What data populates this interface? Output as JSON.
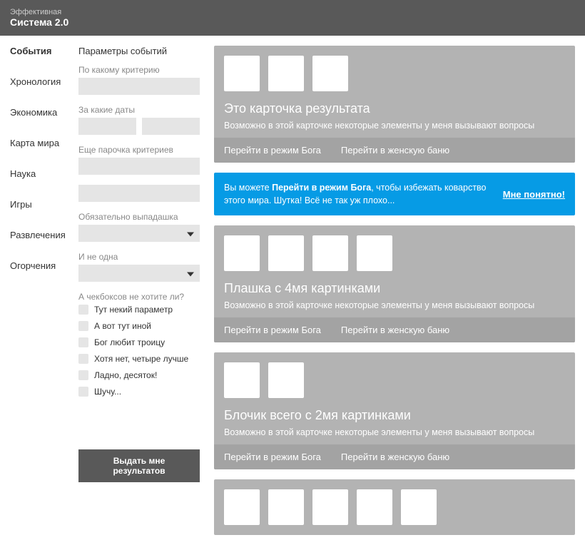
{
  "header": {
    "sub": "Эффективная",
    "title": "Система 2.0"
  },
  "nav": {
    "items": [
      {
        "label": "События",
        "active": true
      },
      {
        "label": "Хронология"
      },
      {
        "label": "Экономика"
      },
      {
        "label": "Карта мира"
      },
      {
        "label": "Наука"
      },
      {
        "label": "Игры"
      },
      {
        "label": "Развлечения"
      },
      {
        "label": "Огорчения"
      }
    ]
  },
  "filters": {
    "title": "Параметры событий",
    "criterion_label": "По какому критерию",
    "dates_label": "За какие даты",
    "more_criteria_label": "Еще парочка критериев",
    "dropdown1_label": "Обязательно выпадашка",
    "dropdown2_label": "И не одна",
    "checkboxes_label": "А чекбоксов не хотите ли?",
    "checkboxes": [
      "Тут некий параметр",
      "А вот тут иной",
      "Бог любит троицу",
      "Хотя нет, четыре лучше",
      "Ладно, десяток!",
      "Шучу..."
    ],
    "submit": "Выдать мне результатов"
  },
  "notice": {
    "text_pre": "Вы можете ",
    "text_bold": "Перейти в режим Бога",
    "text_post": ", чтобы избежать коварство этого мира. Шутка! Всё не так уж плохо...",
    "link": "Мне понятно!"
  },
  "cards": [
    {
      "thumbs": 3,
      "title": "Это карточка результата",
      "desc": "Возможно в этой карточке некоторые элементы у меня вызывают вопросы",
      "action1": "Перейти в режим Бога",
      "action2": "Перейти в женскую баню"
    },
    {
      "thumbs": 4,
      "title": "Плашка с 4мя картинками",
      "desc": "Возможно в этой карточке некоторые элементы у меня вызывают вопросы",
      "action1": "Перейти в режим Бога",
      "action2": "Перейти в женскую баню"
    },
    {
      "thumbs": 2,
      "title": "Блочик всего с 2мя картинками",
      "desc": "Возможно в этой карточке некоторые элементы у меня вызывают вопросы",
      "action1": "Перейти в режим Бога",
      "action2": "Перейти в женскую баню"
    }
  ],
  "bottom_thumbs": 5
}
